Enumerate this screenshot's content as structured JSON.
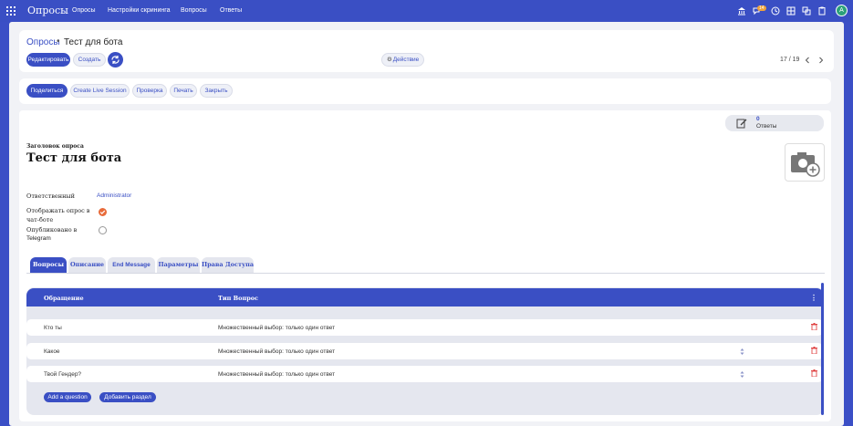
{
  "topbar": {
    "brand": "Опросы",
    "menu": [
      "Опросы",
      "Настройки скрининга",
      "Вопросы",
      "Ответы"
    ],
    "badge_count": "14",
    "avatar_letter": "A",
    "icons": [
      "bank-icon",
      "chat-icon",
      "clock-icon",
      "grid-icon",
      "layers-icon",
      "clipboard-icon"
    ]
  },
  "breadcrumb": {
    "parent": "Опросы",
    "separator": "•",
    "current": "Тест для бота"
  },
  "control": {
    "edit": "Редактировать",
    "create": "Создать",
    "action": "Действие",
    "pager": "17 / 19"
  },
  "statusbar": {
    "buttons": [
      "Поделиться",
      "Create Live Session",
      "Проверка",
      "Печать",
      "Закрыть"
    ]
  },
  "stat": {
    "count": "0",
    "label": "Ответы"
  },
  "form": {
    "title_label": "Заголовок опроса",
    "title": "Тест для бота",
    "responsible_label": "Ответственный",
    "responsible_value": "Administrator",
    "show_in_chat_label_1": "Отображать опрос в",
    "show_in_chat_label_2": "чат-боте",
    "show_in_chat_checked": true,
    "published_label_1": "Опубликовано в",
    "published_label_2": "Telegram",
    "published_checked": false
  },
  "tabs": [
    "Вопросы",
    "Описание",
    "End Message",
    "Параметры",
    "Права Доступа"
  ],
  "table": {
    "headers": [
      "Обращение",
      "Тип Вопрос"
    ],
    "rows": [
      {
        "title": "Кто ты",
        "type": "Множественный выбор: только один ответ"
      },
      {
        "title": "Какое",
        "type": "Множественный выбор: только один ответ"
      },
      {
        "title": "Твой Гендер?",
        "type": "Множественный выбор: только один ответ"
      }
    ],
    "add_question": "Add a question",
    "add_section": "Добавить раздел"
  },
  "colors": {
    "accent": "#3a4fc4",
    "checked": "#e86b3a",
    "background": "#f1f2f6"
  }
}
